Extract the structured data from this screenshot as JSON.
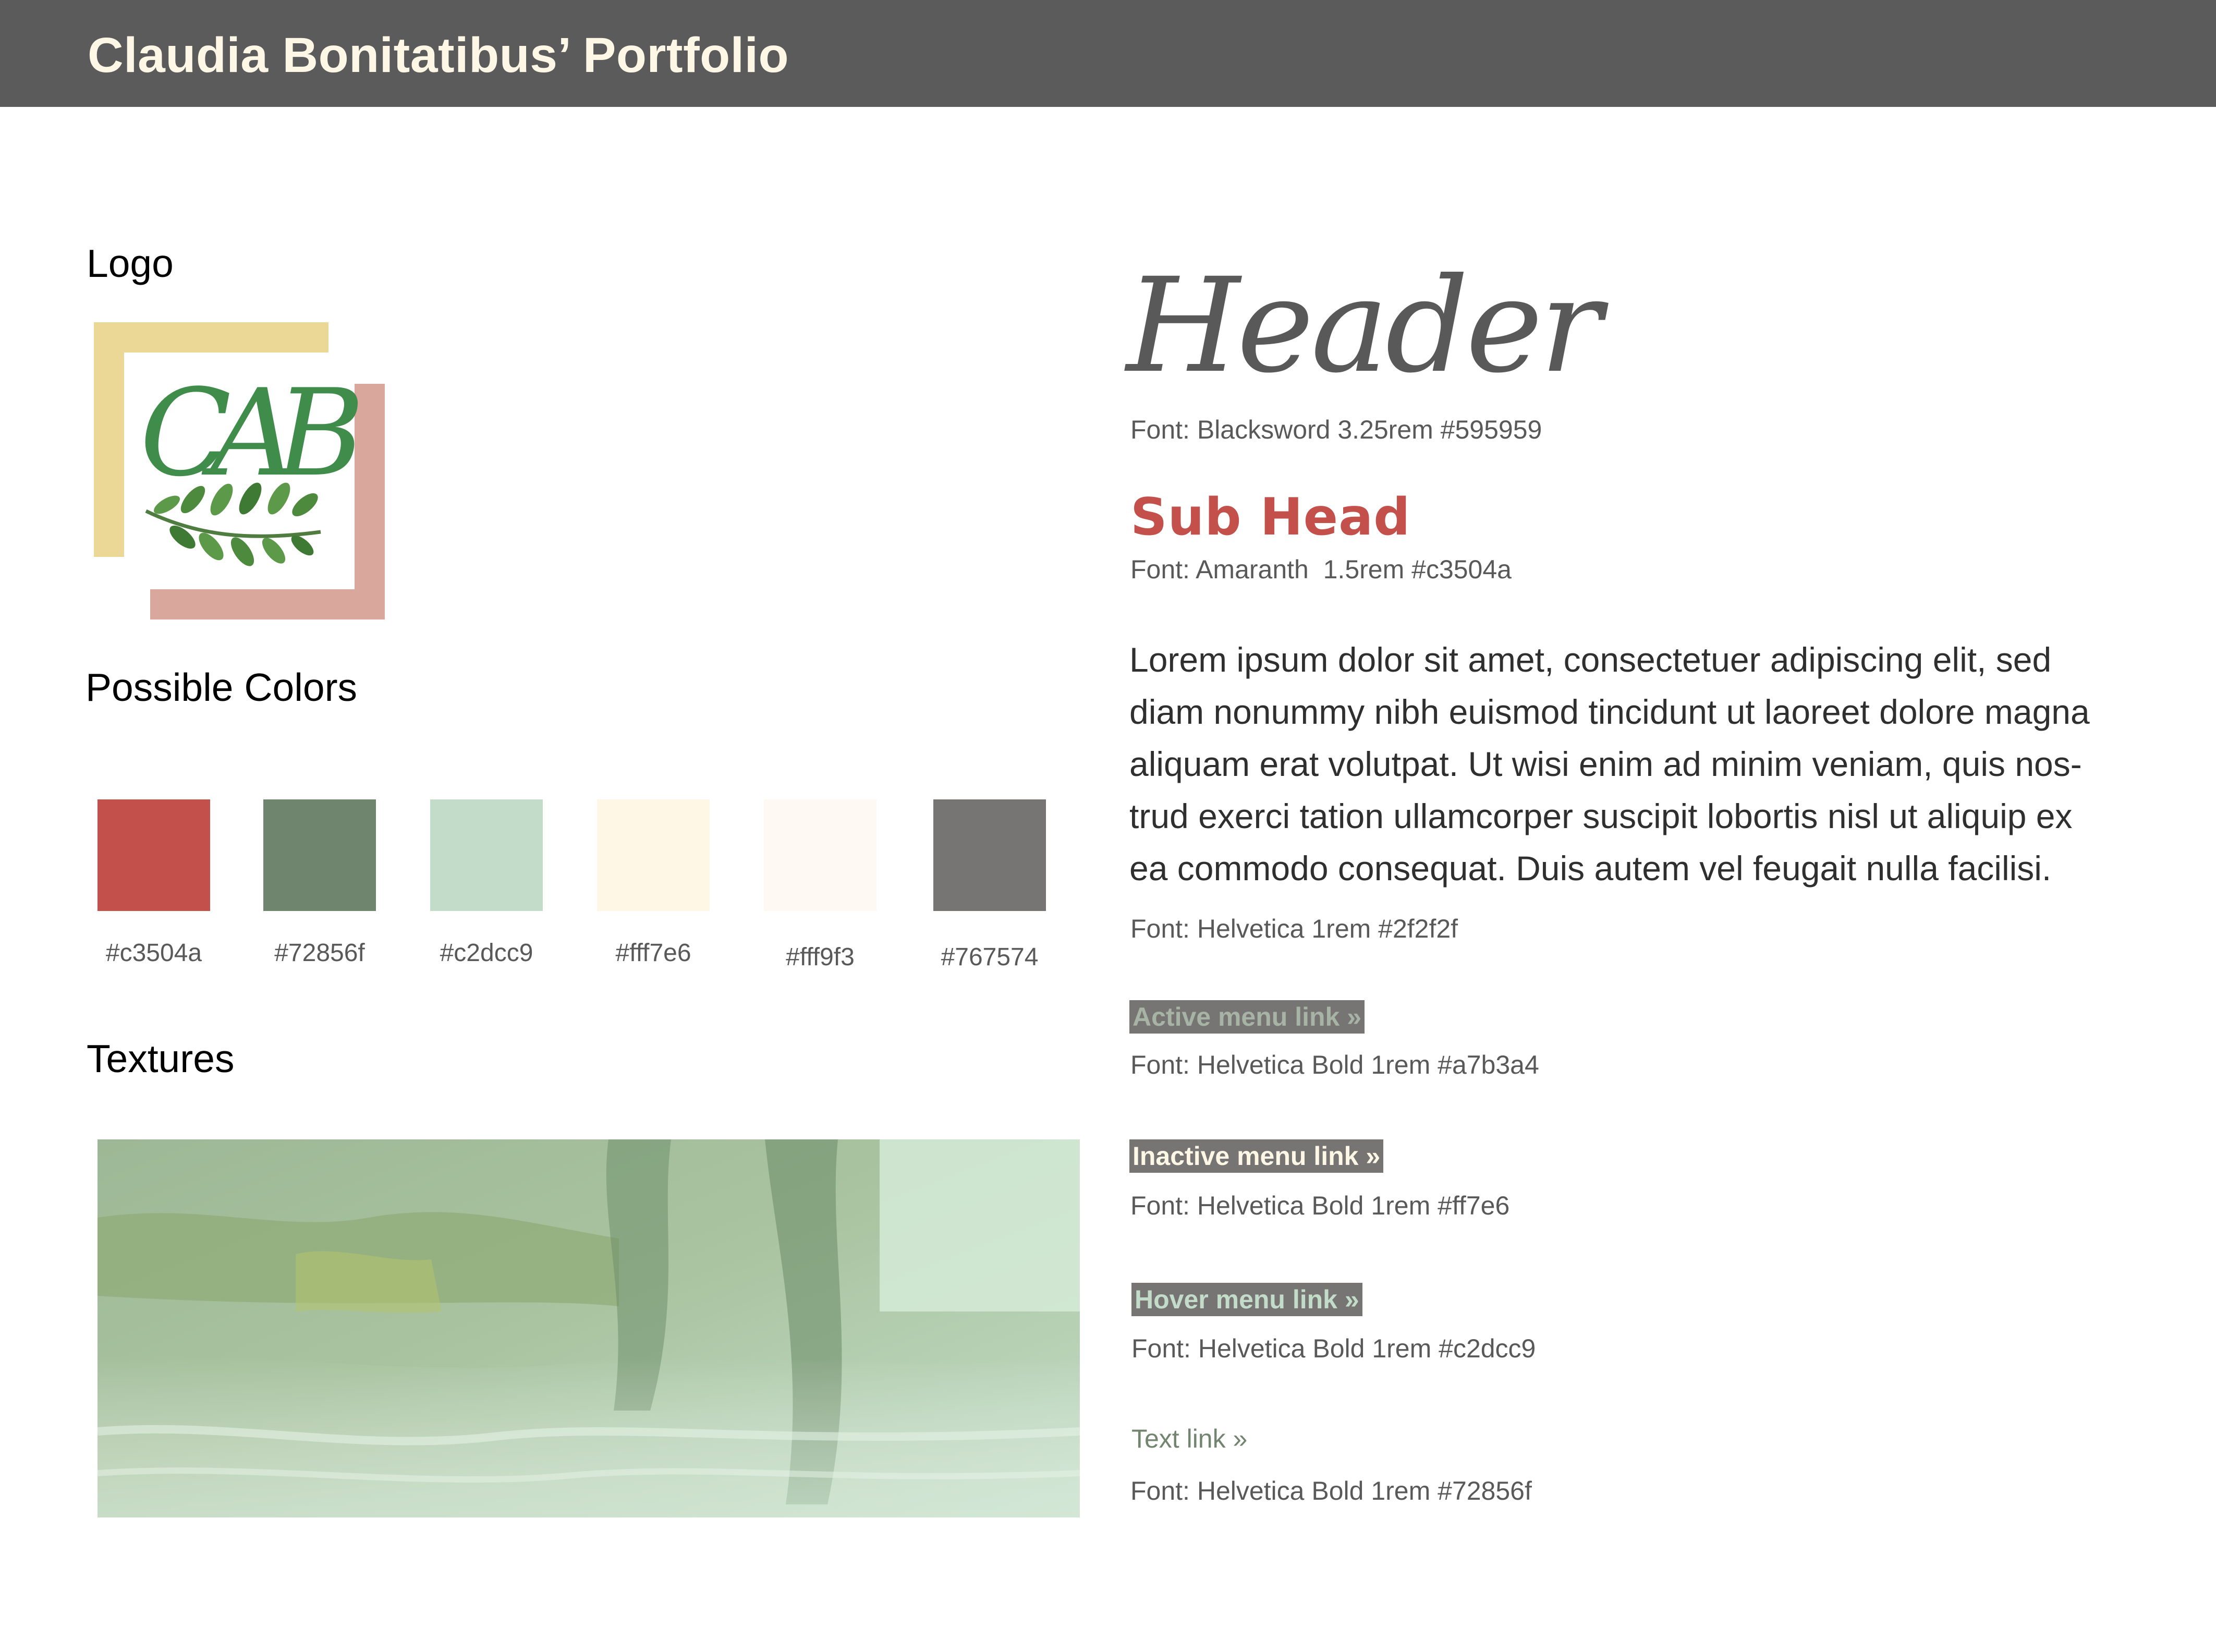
{
  "header": {
    "title": "Claudia Bonitatibus’ Portfolio"
  },
  "sections": {
    "logo": "Logo",
    "colors": "Possible Colors",
    "textures": "Textures"
  },
  "logo": {
    "monogram": "CAB"
  },
  "swatches": [
    {
      "hex": "#c3504a",
      "label": "#c3504a"
    },
    {
      "hex": "#72856f",
      "label": "#72856f"
    },
    {
      "hex": "#c2dcc9",
      "label": "#c2dcc9"
    },
    {
      "hex": "#fff7e6",
      "label": "#fff7e6"
    },
    {
      "hex": "#fff9f3",
      "label": "#fff9f3"
    },
    {
      "hex": "#767574",
      "label": "#767574"
    }
  ],
  "typography": {
    "header_sample": "Header",
    "header_spec": "Font: Blacksword 3.25rem #595959",
    "subhead_sample": "Sub Head",
    "subhead_spec": "Font: Amaranth  1.5rem #c3504a",
    "body_sample": "Lorem ipsum dolor sit amet, consectetuer adipiscing elit, sed diam nonummy nibh euismod tincidunt ut laoreet dolore magna aliquam erat volutpat. Ut wisi enim ad minim veniam, quis nos-trud exerci tation ullamcorper suscipit lobortis nisl ut aliquip ex ea commodo consequat. Duis autem vel feugait nulla facilisi.",
    "body_spec": "Font: Helvetica 1rem #2f2f2f"
  },
  "links": {
    "active_label": "Active menu link »",
    "active_spec": "Font: Helvetica Bold 1rem #a7b3a4",
    "inactive_label": "Inactive menu link »",
    "inactive_spec": "Font: Helvetica Bold 1rem #ff7e6",
    "hover_label": "Hover menu link »",
    "hover_spec": "Font: Helvetica Bold 1rem #c2dcc9",
    "text_label": "Text link »",
    "text_spec": "Font: Helvetica Bold 1rem #72856f"
  },
  "colors": {
    "topbar": "#5b5b5b",
    "active_link": "#a7b3a4",
    "inactive_link": "#fff7e6",
    "hover_link": "#c2dcc9"
  }
}
